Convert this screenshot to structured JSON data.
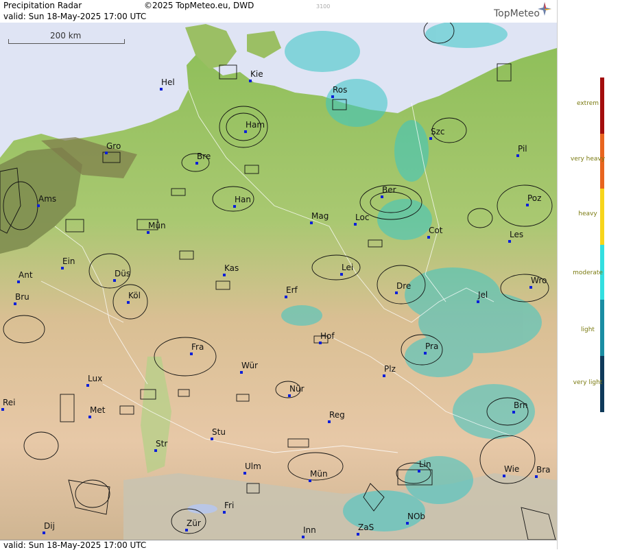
{
  "header": {
    "title": "Precipitation Radar",
    "copyright": "©2025 TopMeteo.eu, DWD",
    "code": "3100",
    "valid": "valid:  Sun  18-May-2025 17:00 UTC",
    "logo": "TopMeteo"
  },
  "footer": {
    "valid": "valid:  Sun  18-May-2025 17:00 UTC"
  },
  "scale": {
    "label": "200 km"
  },
  "legend": {
    "levels": [
      {
        "label": "extrem",
        "color": "#a30d0d"
      },
      {
        "label": "very heavy",
        "color": "#e8651f"
      },
      {
        "label": "heavy",
        "color": "#f7d51b"
      },
      {
        "label": "moderate",
        "color": "#33dfe0"
      },
      {
        "label": "light",
        "color": "#1a8da3"
      },
      {
        "label": "very light",
        "color": "#0f3a5a"
      }
    ]
  },
  "cities": [
    {
      "name": "Hel"
    },
    {
      "name": "Kie"
    },
    {
      "name": "Ros"
    },
    {
      "name": "Ham"
    },
    {
      "name": "Szc"
    },
    {
      "name": "Gro"
    },
    {
      "name": "Bre"
    },
    {
      "name": "Pil"
    },
    {
      "name": "Ams"
    },
    {
      "name": "Ber"
    },
    {
      "name": "Han"
    },
    {
      "name": "Poz"
    },
    {
      "name": "Mün"
    },
    {
      "name": "Mag"
    },
    {
      "name": "Loc"
    },
    {
      "name": "Cot"
    },
    {
      "name": "Les"
    },
    {
      "name": "Ein"
    },
    {
      "name": "Kas"
    },
    {
      "name": "Lei"
    },
    {
      "name": "Ant"
    },
    {
      "name": "Düs"
    },
    {
      "name": "Dre"
    },
    {
      "name": "Wro"
    },
    {
      "name": "Bru"
    },
    {
      "name": "Köl"
    },
    {
      "name": "Erf"
    },
    {
      "name": "Jel"
    },
    {
      "name": "Hof"
    },
    {
      "name": "Fra"
    },
    {
      "name": "Pra"
    },
    {
      "name": "Lux"
    },
    {
      "name": "Wür"
    },
    {
      "name": "Plz"
    },
    {
      "name": "Rei"
    },
    {
      "name": "Nür"
    },
    {
      "name": "Met"
    },
    {
      "name": "Reg"
    },
    {
      "name": "Brn"
    },
    {
      "name": "Stu"
    },
    {
      "name": "Str"
    },
    {
      "name": "Ulm"
    },
    {
      "name": "Mün"
    },
    {
      "name": "Lin"
    },
    {
      "name": "Wie"
    },
    {
      "name": "Bra"
    },
    {
      "name": "Fri"
    },
    {
      "name": "Dij"
    },
    {
      "name": "Zür"
    },
    {
      "name": "Inn"
    },
    {
      "name": "ZaS"
    },
    {
      "name": "NOb"
    }
  ]
}
